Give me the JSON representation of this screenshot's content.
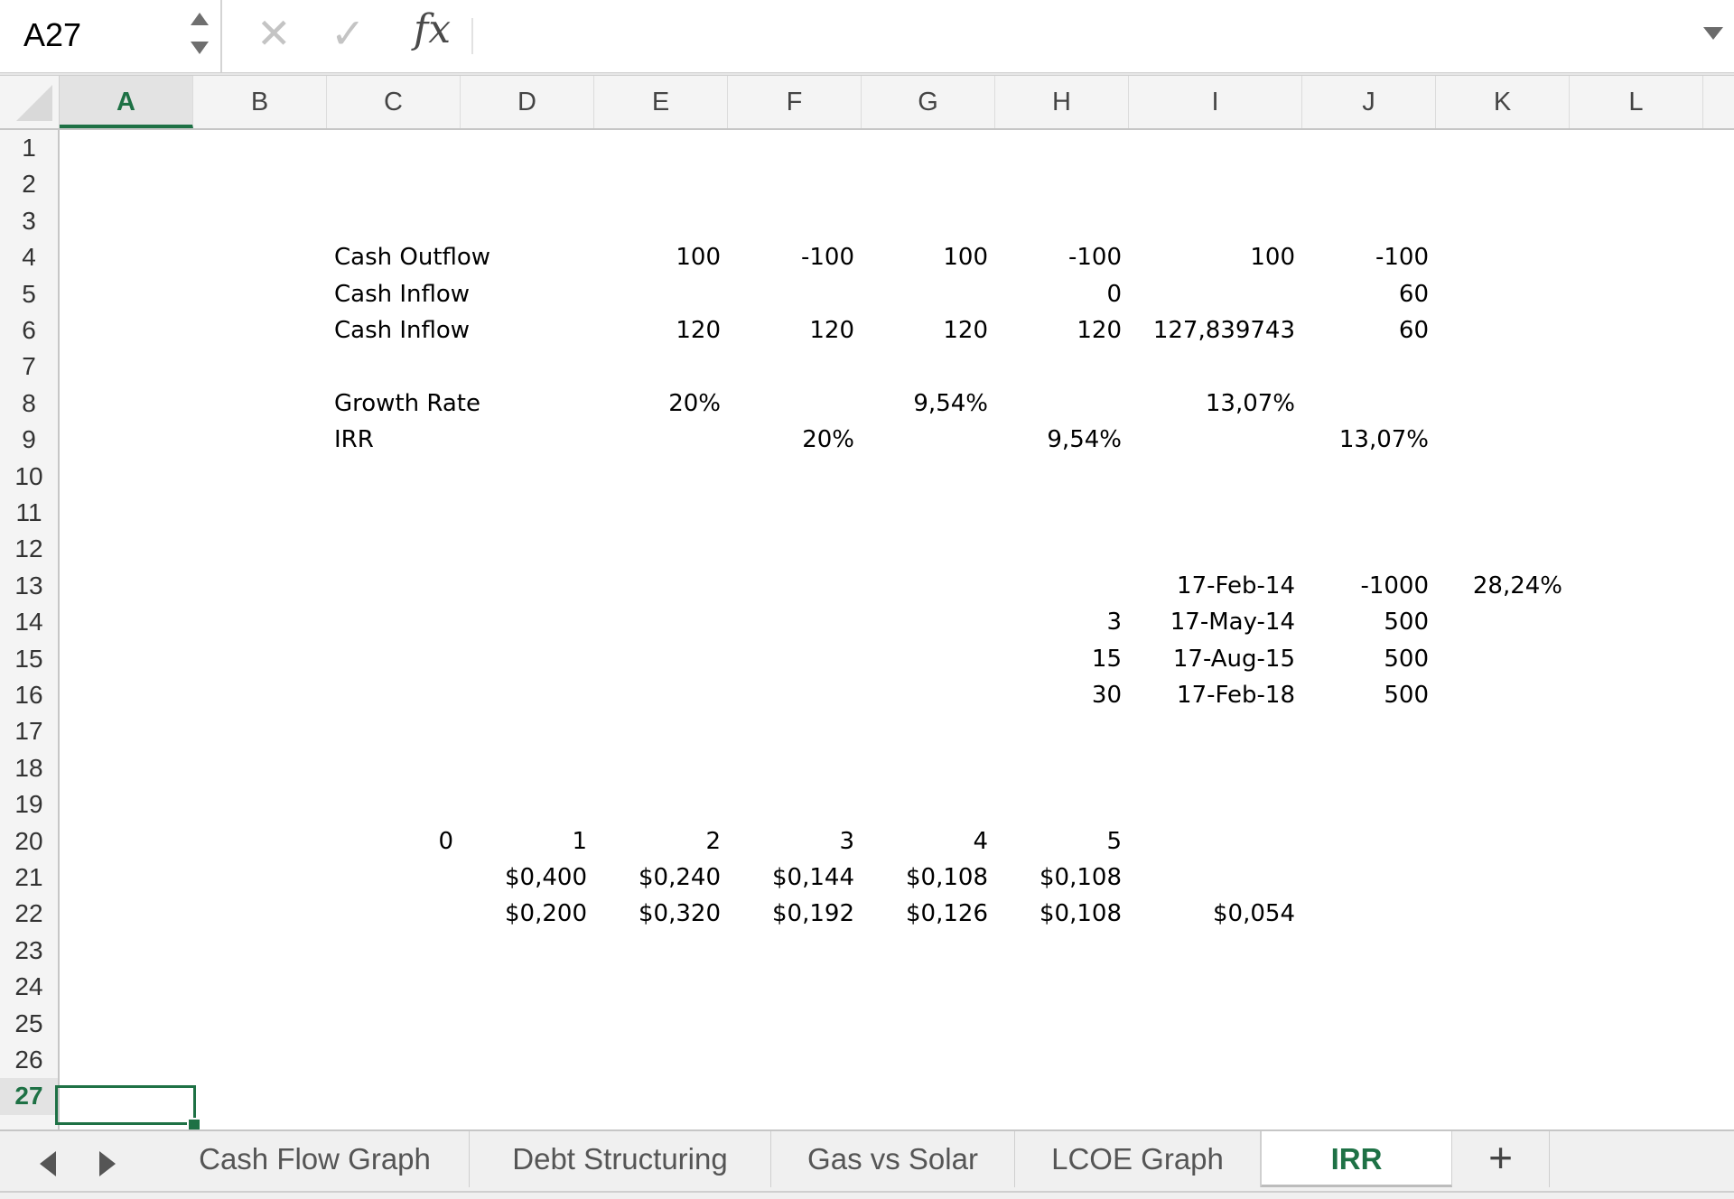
{
  "formula_bar": {
    "name_box": "A27",
    "cancel_icon": "✕",
    "enter_icon": "✓",
    "fx_label": "fx",
    "formula": ""
  },
  "columns": [
    "A",
    "B",
    "C",
    "D",
    "E",
    "F",
    "G",
    "H",
    "I",
    "J",
    "K",
    "L"
  ],
  "rows": [
    "1",
    "2",
    "3",
    "4",
    "5",
    "6",
    "7",
    "8",
    "9",
    "10",
    "11",
    "12",
    "13",
    "14",
    "15",
    "16",
    "17",
    "18",
    "19",
    "20",
    "21",
    "22",
    "23",
    "24",
    "25",
    "26",
    "27"
  ],
  "active": {
    "column": "A",
    "row": "27",
    "accent_color": "#1e7145"
  },
  "cells": {
    "C4": "Cash Outflow",
    "E4": "100",
    "F4": "-100",
    "G4": "100",
    "H4": "-100",
    "I4": "100",
    "J4": "-100",
    "C5": "Cash Inflow",
    "H5": "0",
    "J5": "60",
    "C6": "Cash Inflow",
    "E6": "120",
    "F6": "120",
    "G6": "120",
    "H6": "120",
    "I6": "127,839743",
    "J6": "60",
    "C8": "Growth Rate",
    "E8": "20%",
    "G8": "9,54%",
    "I8": "13,07%",
    "C9": "IRR",
    "F9": "20%",
    "H9": "9,54%",
    "J9": "13,07%",
    "I13": "17-Feb-14",
    "J13": "-1000",
    "K13": "28,24%",
    "H14": "3",
    "I14": "17-May-14",
    "J14": "500",
    "H15": "15",
    "I15": "17-Aug-15",
    "J15": "500",
    "H16": "30",
    "I16": "17-Feb-18",
    "J16": "500",
    "C20": "0",
    "D20": "1",
    "E20": "2",
    "F20": "3",
    "G20": "4",
    "H20": "5",
    "D21": "$0,400",
    "E21": "$0,240",
    "F21": "$0,144",
    "G21": "$0,108",
    "H21": "$0,108",
    "D22": "$0,200",
    "E22": "$0,320",
    "F22": "$0,192",
    "G22": "$0,126",
    "H22": "$0,108",
    "I22": "$0,054"
  },
  "sheet_tabs": [
    {
      "label": "Cash Flow Graph",
      "active": false
    },
    {
      "label": "Debt Structuring",
      "active": false
    },
    {
      "label": "Gas vs Solar",
      "active": false
    },
    {
      "label": "LCOE Graph",
      "active": false
    },
    {
      "label": "IRR",
      "active": true
    }
  ],
  "add_sheet_label": "+"
}
